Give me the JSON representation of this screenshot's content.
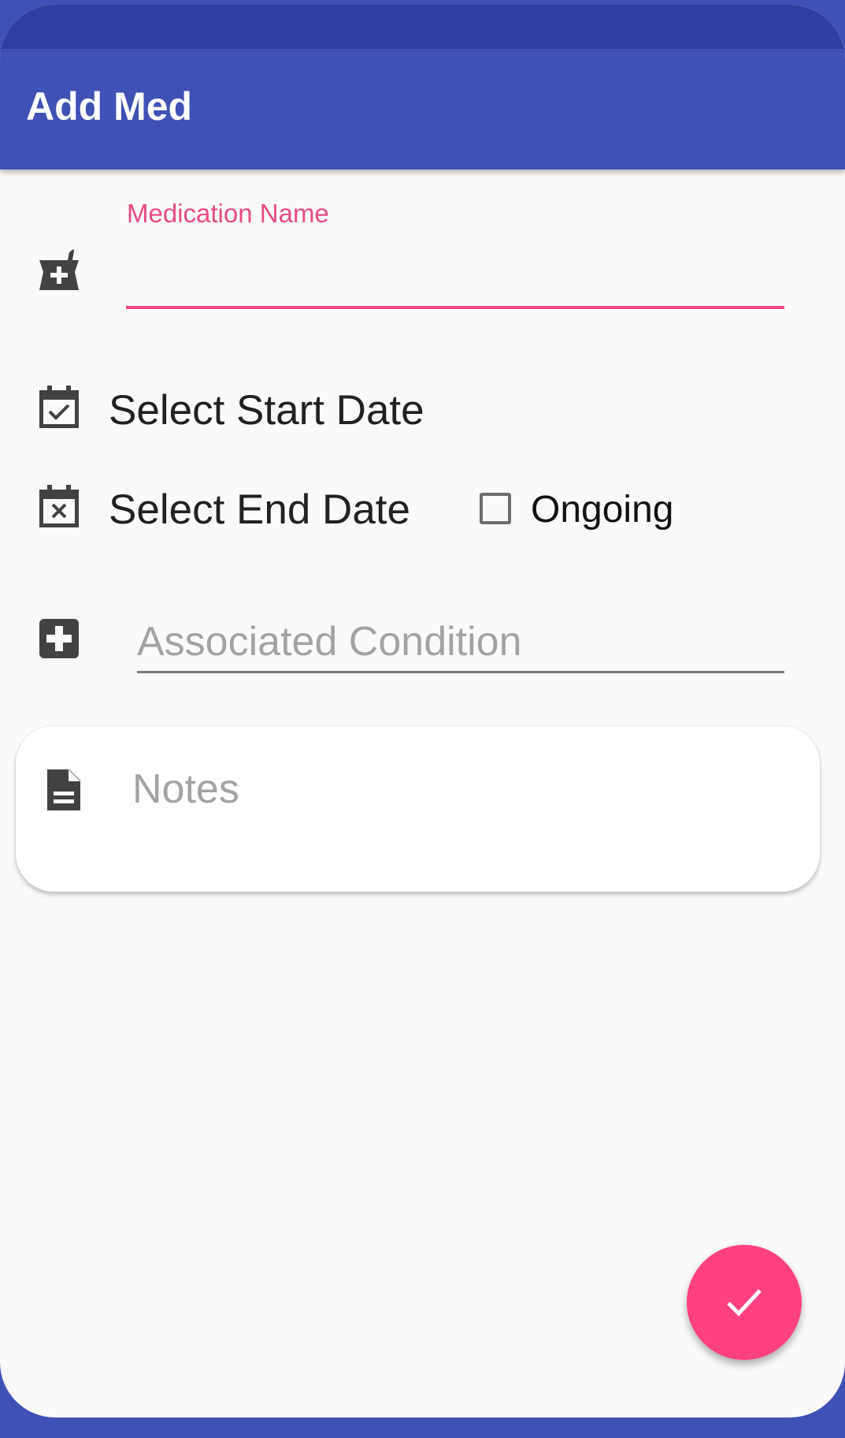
{
  "app_bar": {
    "title": "Add Med"
  },
  "form": {
    "medication_name": {
      "label": "Medication Name",
      "value": ""
    },
    "start_date": {
      "label": "Select Start Date"
    },
    "end_date": {
      "label": "Select End Date"
    },
    "ongoing": {
      "label": "Ongoing",
      "checked": false
    },
    "associated_condition": {
      "placeholder": "Associated Condition",
      "value": ""
    },
    "notes": {
      "placeholder": "Notes",
      "value": ""
    }
  },
  "icons": {
    "medication": "mortar-pestle-plus-icon",
    "start_date": "calendar-check-icon",
    "end_date": "calendar-remove-icon",
    "condition": "medical-plus-icon",
    "notes": "document-icon",
    "fab": "check-icon"
  },
  "colors": {
    "primary": "#3f51b5",
    "primary_dark": "#303f9f",
    "accent": "#ff4081",
    "focus_label": "#e84a85"
  }
}
